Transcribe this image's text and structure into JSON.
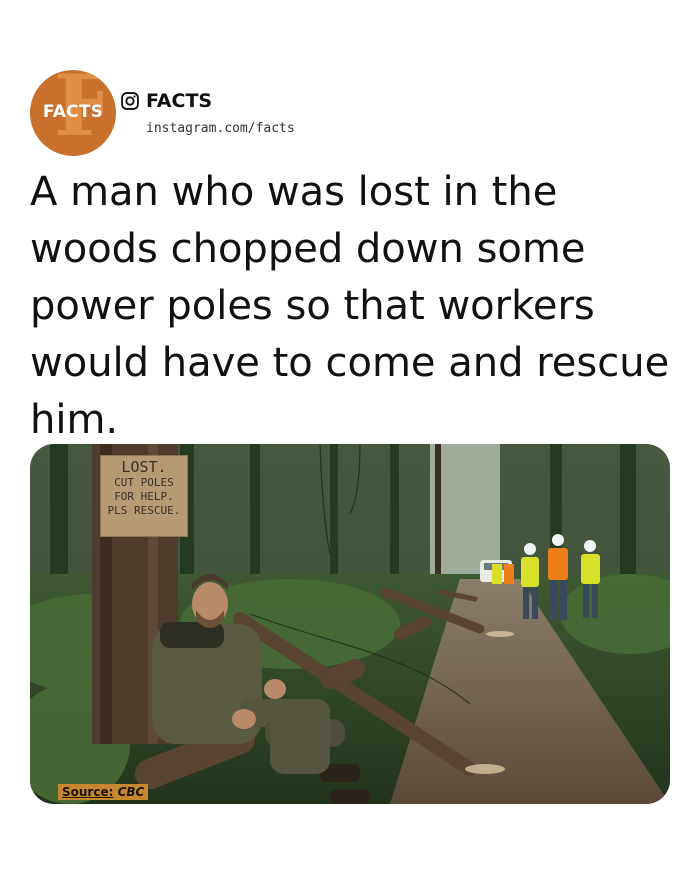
{
  "brand": {
    "logo_text": "FACTS",
    "handle": "FACTS",
    "url": "instagram.com/facts",
    "logo_color": "#c9702d"
  },
  "headline": "A man who was lost in the woods chopped down some power poles so that workers would have to come and rescue him.",
  "image": {
    "sign": {
      "line1": "LOST.",
      "line2": "CUT POLES",
      "line3": "FOR HELP.",
      "line4": "PLS RESCUE."
    },
    "source_label": "Source:",
    "source_value": "CBC"
  }
}
